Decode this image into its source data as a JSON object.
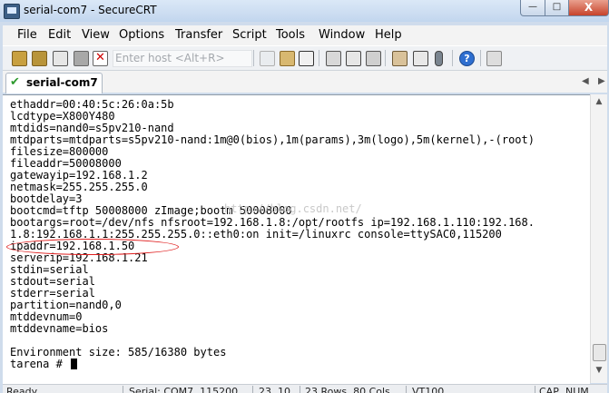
{
  "window": {
    "title": "serial-com7 - SecureCRT"
  },
  "window_controls": {
    "minimize": "—",
    "maximize": "□",
    "close": "X"
  },
  "menu": [
    "File",
    "Edit",
    "View",
    "Options",
    "Transfer",
    "Script",
    "Tools",
    "Window",
    "Help"
  ],
  "toolbar": {
    "quick_connect_placeholder": "Enter host <Alt+R>"
  },
  "tab": {
    "label": "serial-com7",
    "status_glyph": "✔"
  },
  "terminal": {
    "lines": [
      "ethaddr=00:40:5c:26:0a:5b",
      "lcdtype=X800Y480",
      "mtdids=nand0=s5pv210-nand",
      "mtdparts=mtdparts=s5pv210-nand:1m@0(bios),1m(params),3m(logo),5m(kernel),-(root)",
      "filesize=800000",
      "fileaddr=50008000",
      "gatewayip=192.168.1.2",
      "netmask=255.255.255.0",
      "bootdelay=3",
      "bootcmd=tftp 50008000 zImage;bootm 50008000",
      "bootargs=root=/dev/nfs nfsroot=192.168.1.8:/opt/rootfs ip=192.168.1.110:192.168.",
      "1.8:192.168.1.1:255.255.255.0::eth0:on init=/linuxrc console=ttySAC0,115200",
      "ipaddr=192.168.1.50",
      "serverip=192.168.1.21",
      "stdin=serial",
      "stdout=serial",
      "stderr=serial",
      "partition=nand0,0",
      "mtddevnum=0",
      "mtddevname=bios",
      "",
      "Environment size: 585/16380 bytes",
      "tarena # "
    ],
    "watermark": "http://blog.csdn.net/"
  },
  "status": {
    "ready": "Ready",
    "connection": "Serial: COM7, 115200",
    "cursor": "23, 10",
    "size": "23 Rows, 80 Cols",
    "emulation": "VT100",
    "cap": "CAP",
    "num": "NUM"
  }
}
